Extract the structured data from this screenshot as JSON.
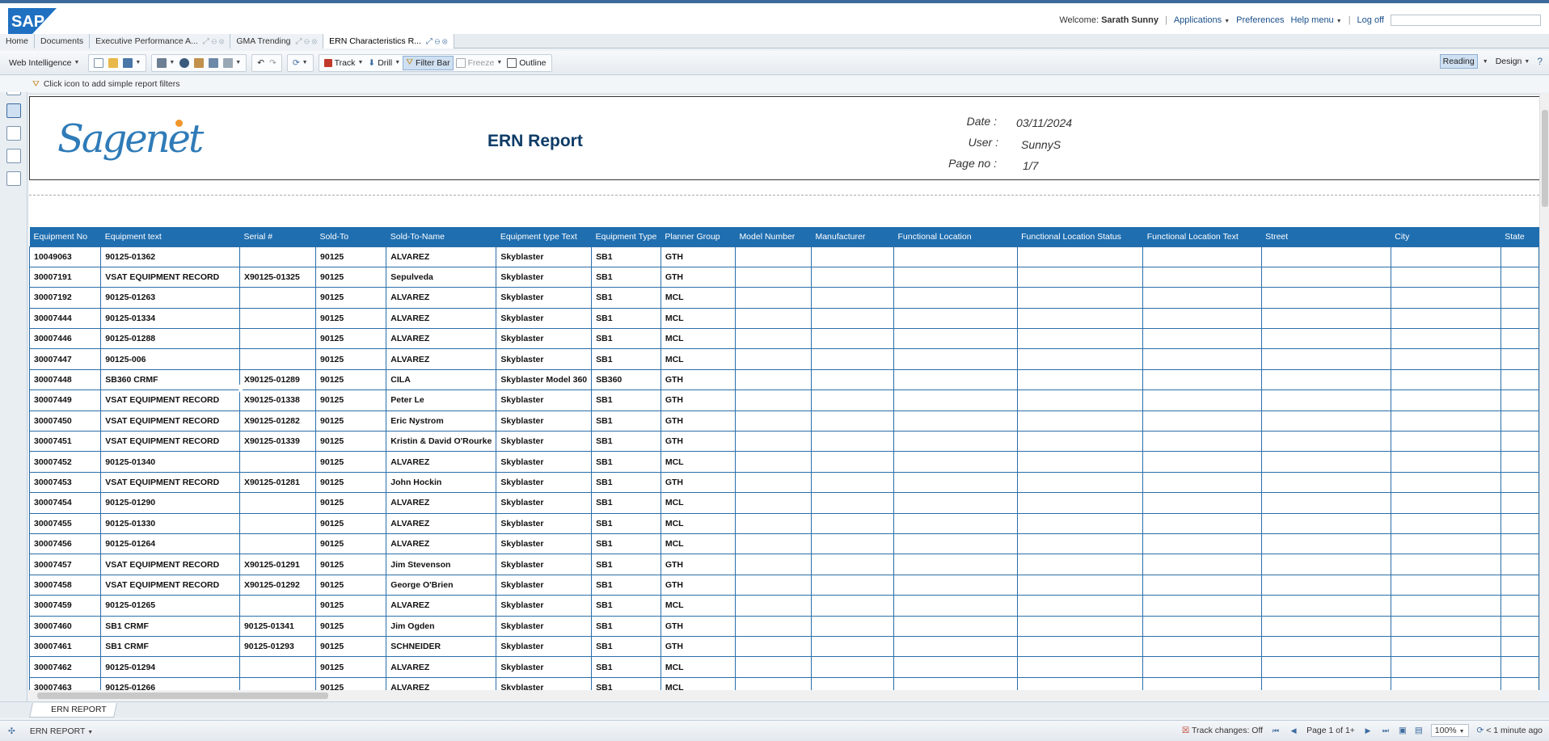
{
  "header": {
    "logo": "SAP",
    "welcome_prefix": "Welcome:",
    "user_name": "Sarath Sunny",
    "applications": "Applications",
    "preferences": "Preferences",
    "help_menu": "Help menu",
    "log_off": "Log off"
  },
  "tabs": [
    "Home",
    "Documents",
    "Executive Performance A...",
    "GMA Trending",
    "ERN Characteristics R..."
  ],
  "toolbar": {
    "web_intelligence": "Web Intelligence",
    "track": "Track",
    "drill": "Drill",
    "filter_bar": "Filter Bar",
    "freeze": "Freeze",
    "outline": "Outline",
    "reading": "Reading",
    "design": "Design"
  },
  "filterbar": {
    "hint": "Click icon to add simple report filters"
  },
  "report": {
    "logo_text": "Sagenet",
    "title": "ERN Report",
    "date_label": "Date :",
    "date_value": "03/11/2024",
    "user_label": "User :",
    "user_value": "SunnyS",
    "page_label": "Page no :",
    "page_value": "1/7"
  },
  "table": {
    "columns": [
      "Equipment No",
      "Equipment text",
      "Serial #",
      "Sold-To",
      "Sold-To-Name",
      "Equipment type Text",
      "Equipment Type",
      "Planner Group",
      "Model Number",
      "Manufacturer",
      "Functional Location",
      "Functional Location Status",
      "Functional Location Text",
      "Street",
      "City",
      "State"
    ],
    "rows": [
      [
        "10049063",
        "90125-01362",
        "",
        "90125",
        "ALVAREZ",
        "Skyblaster",
        "SB1",
        "GTH"
      ],
      [
        "30007191",
        "VSAT EQUIPMENT RECORD",
        "X90125-01325",
        "90125",
        "Sepulveda",
        "Skyblaster",
        "SB1",
        "GTH"
      ],
      [
        "30007192",
        "90125-01263",
        "",
        "90125",
        "ALVAREZ",
        "Skyblaster",
        "SB1",
        "MCL"
      ],
      [
        "30007444",
        "90125-01334",
        "",
        "90125",
        "ALVAREZ",
        "Skyblaster",
        "SB1",
        "MCL"
      ],
      [
        "30007446",
        "90125-01288",
        "",
        "90125",
        "ALVAREZ",
        "Skyblaster",
        "SB1",
        "MCL"
      ],
      [
        "30007447",
        "90125-006",
        "",
        "90125",
        "ALVAREZ",
        "Skyblaster",
        "SB1",
        "MCL"
      ],
      [
        "30007448",
        "SB360  CRMF",
        "X90125-01289",
        "90125",
        "CILA",
        "Skyblaster Model 360",
        "SB360",
        "GTH"
      ],
      [
        "30007449",
        "VSAT EQUIPMENT RECORD",
        "X90125-01338",
        "90125",
        "Peter Le",
        "Skyblaster",
        "SB1",
        "GTH"
      ],
      [
        "30007450",
        "VSAT EQUIPMENT RECORD",
        "X90125-01282",
        "90125",
        "Eric Nystrom",
        "Skyblaster",
        "SB1",
        "GTH"
      ],
      [
        "30007451",
        "VSAT EQUIPMENT RECORD",
        "X90125-01339",
        "90125",
        "Kristin & David O'Rourke",
        "Skyblaster",
        "SB1",
        "GTH"
      ],
      [
        "30007452",
        "90125-01340",
        "",
        "90125",
        "ALVAREZ",
        "Skyblaster",
        "SB1",
        "MCL"
      ],
      [
        "30007453",
        "VSAT EQUIPMENT RECORD",
        "X90125-01281",
        "90125",
        "John Hockin",
        "Skyblaster",
        "SB1",
        "GTH"
      ],
      [
        "30007454",
        "90125-01290",
        "",
        "90125",
        "ALVAREZ",
        "Skyblaster",
        "SB1",
        "MCL"
      ],
      [
        "30007455",
        "90125-01330",
        "",
        "90125",
        "ALVAREZ",
        "Skyblaster",
        "SB1",
        "MCL"
      ],
      [
        "30007456",
        "90125-01264",
        "",
        "90125",
        "ALVAREZ",
        "Skyblaster",
        "SB1",
        "MCL"
      ],
      [
        "30007457",
        "VSAT EQUIPMENT RECORD",
        "X90125-01291",
        "90125",
        "Jim Stevenson",
        "Skyblaster",
        "SB1",
        "GTH"
      ],
      [
        "30007458",
        "VSAT EQUIPMENT RECORD",
        "X90125-01292",
        "90125",
        "George O'Brien",
        "Skyblaster",
        "SB1",
        "GTH"
      ],
      [
        "30007459",
        "90125-01265",
        "",
        "90125",
        "ALVAREZ",
        "Skyblaster",
        "SB1",
        "MCL"
      ],
      [
        "30007460",
        "SB1  CRMF",
        "90125-01341",
        "90125",
        "Jim Ogden",
        "Skyblaster",
        "SB1",
        "GTH"
      ],
      [
        "30007461",
        "SB1  CRMF",
        "90125-01293",
        "90125",
        "SCHNEIDER",
        "Skyblaster",
        "SB1",
        "GTH"
      ],
      [
        "30007462",
        "90125-01294",
        "",
        "90125",
        "ALVAREZ",
        "Skyblaster",
        "SB1",
        "MCL"
      ],
      [
        "30007463",
        "90125-01266",
        "",
        "90125",
        "ALVAREZ",
        "Skyblaster",
        "SB1",
        "MCL"
      ]
    ]
  },
  "report_tab": "ERN REPORT",
  "status": {
    "report_name": "ERN REPORT",
    "track_changes": "Track changes: Off",
    "page": "Page 1 of 1+",
    "zoom": "100%",
    "last_refresh": "< 1 minute ago"
  }
}
